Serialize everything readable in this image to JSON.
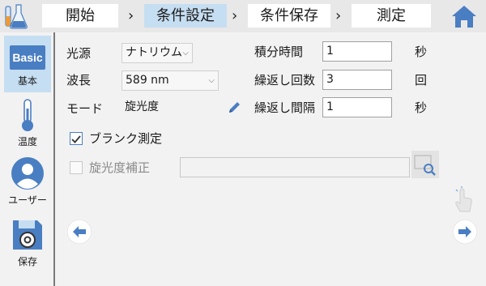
{
  "steps": [
    "開始",
    "条件設定",
    "条件保存",
    "測定"
  ],
  "active_step": 1,
  "icons": {
    "app": "flask-icon",
    "home": "home-icon",
    "thermometer": "thermometer-icon",
    "user": "user-icon",
    "save": "save-icon",
    "pencil": "pencil-icon",
    "search": "search-icon",
    "back": "arrow-left-icon",
    "forward": "arrow-right-icon",
    "touch": "touch-icon"
  },
  "sidebar": {
    "items": [
      {
        "badge": "Basic",
        "label": "基本"
      },
      {
        "label": "温度"
      },
      {
        "label": "ユーザー"
      },
      {
        "label": "保存"
      }
    ]
  },
  "form": {
    "light_source": {
      "label": "光源",
      "value": "ナトリウム"
    },
    "wavelength": {
      "label": "波長",
      "value": "589 nm"
    },
    "mode": {
      "label": "モード",
      "value": "旋光度"
    },
    "integration_time": {
      "label": "積分時間",
      "value": "1",
      "unit": "秒"
    },
    "repeat_count": {
      "label": "繰返し回数",
      "value": "3",
      "unit": "回"
    },
    "repeat_interval": {
      "label": "繰返し間隔",
      "value": "1",
      "unit": "秒"
    },
    "blank_measure": {
      "label": "ブランク測定",
      "checked": true
    },
    "rotation_correction": {
      "label": "旋光度補正",
      "checked": false,
      "value": ""
    }
  },
  "colors": {
    "accent": "#4a7ec2",
    "active_tab": "#c6def2"
  }
}
